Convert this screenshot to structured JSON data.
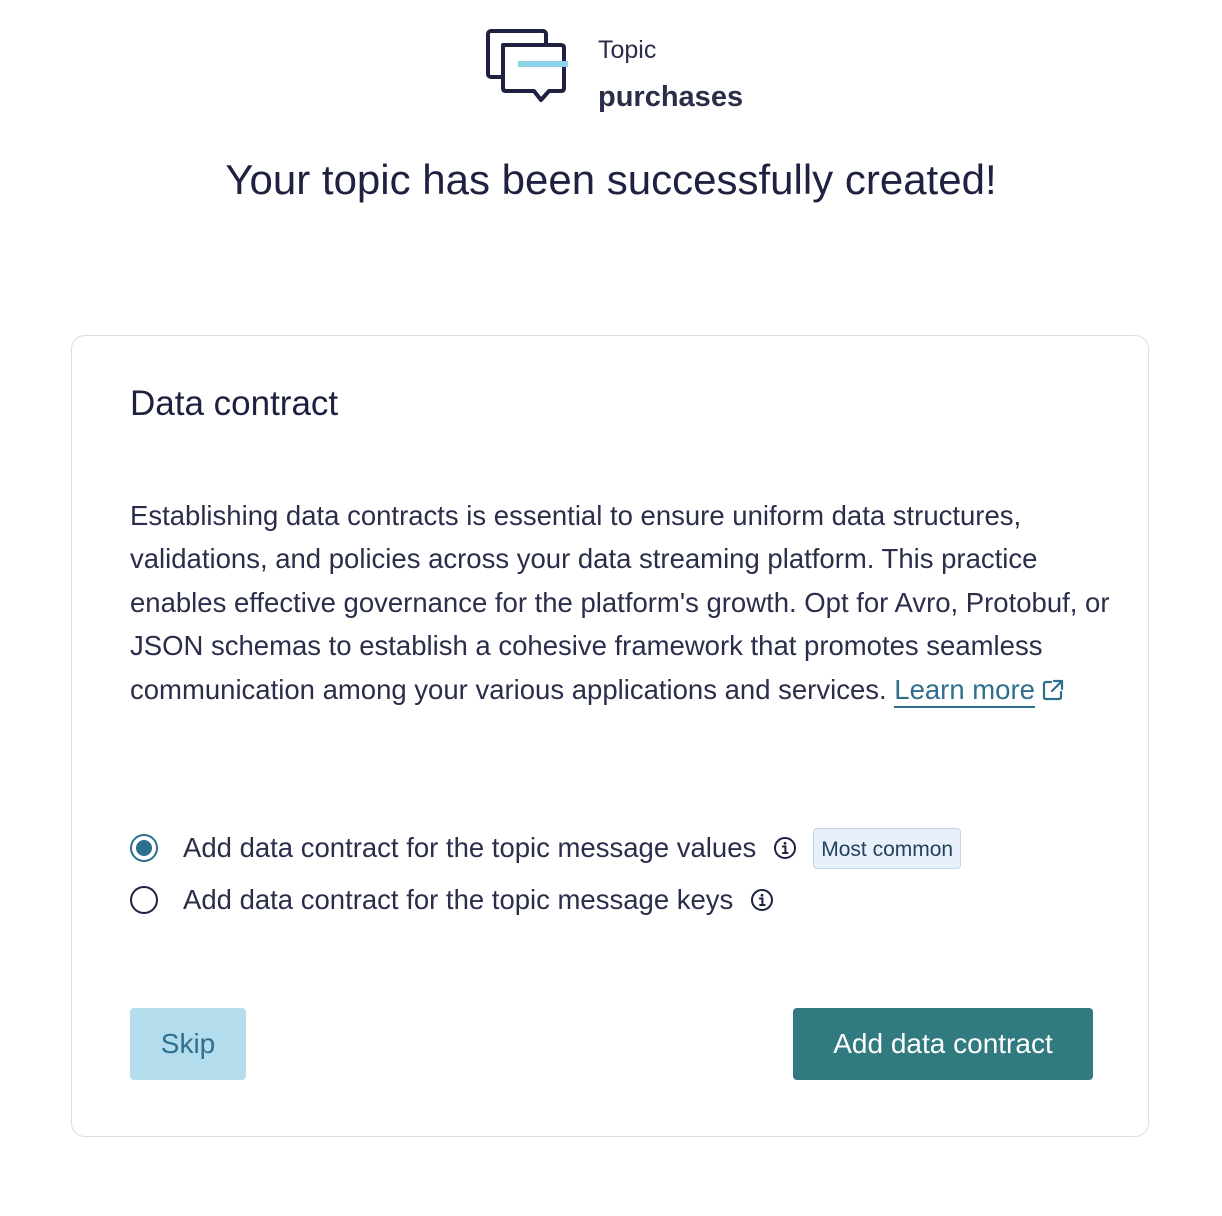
{
  "header": {
    "icon": "chat-bubbles-icon",
    "topic_label": "Topic",
    "topic_name": "purchases"
  },
  "page_title": "Your topic has been successfully created!",
  "card": {
    "title": "Data contract",
    "description": "Establishing data contracts is essential to ensure uniform data structures, validations, and policies across your data streaming platform. This practice enables effective governance for the platform's growth. Opt for Avro, Protobuf, or JSON schemas to establish a cohesive framework that promotes seamless communication among your various applications and services.",
    "learn_more_label": "Learn more",
    "options": [
      {
        "label": "Add data contract for the topic message values",
        "selected": true,
        "badge": "Most common"
      },
      {
        "label": "Add data contract for the topic message keys",
        "selected": false
      }
    ],
    "skip_label": "Skip",
    "primary_label": "Add data contract"
  },
  "colors": {
    "text": "#1e2140",
    "link": "#2f6f8e",
    "icon_accent": "#8fd3ea",
    "skip_bg": "#b3dced",
    "primary_bg": "#317b80",
    "badge_bg": "#e8f1fb"
  }
}
